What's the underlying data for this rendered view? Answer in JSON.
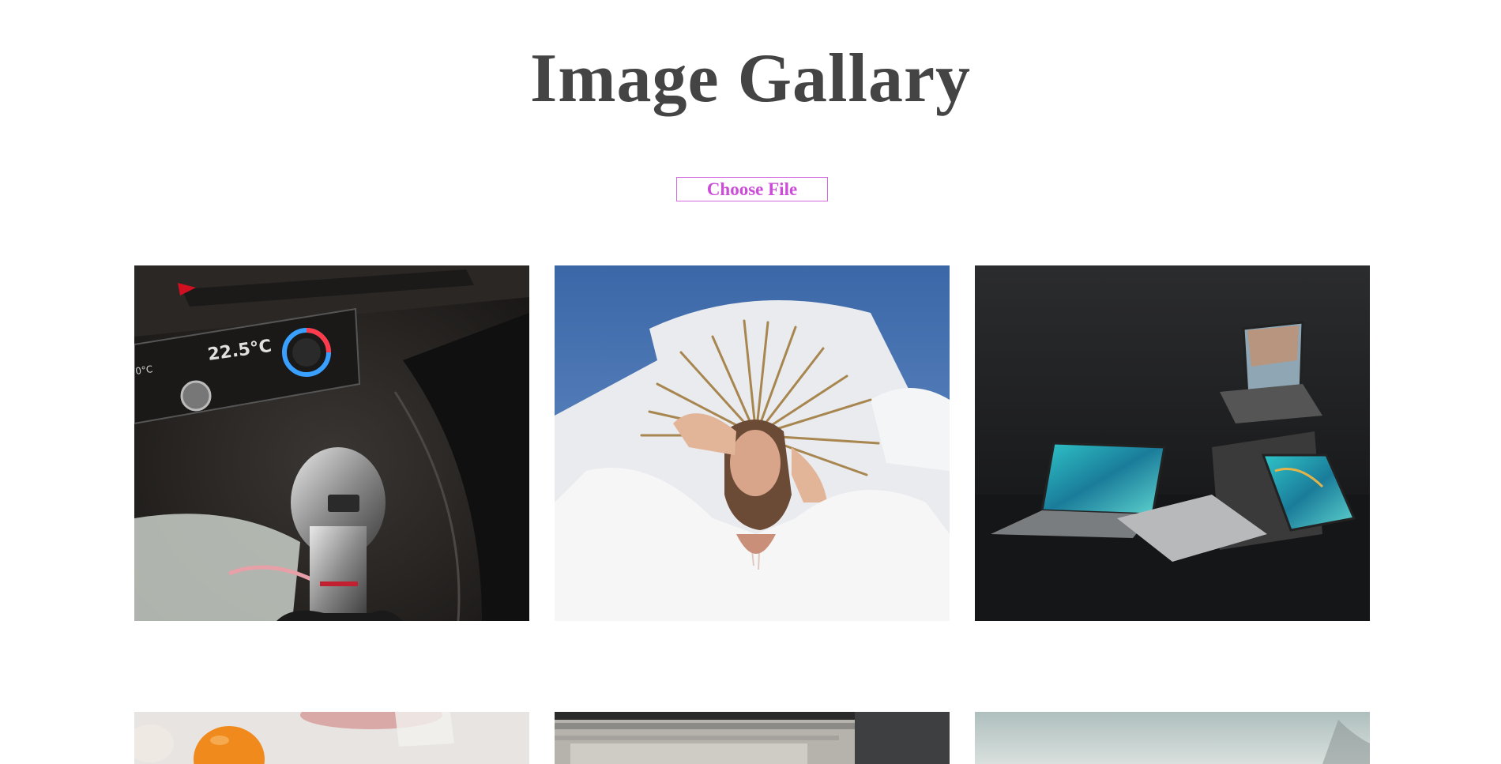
{
  "page": {
    "title": "Image Gallary"
  },
  "upload": {
    "button_label": "Choose File"
  },
  "colors": {
    "title": "#444444",
    "upload_accent": "#cc4cd9",
    "upload_border": "#d36ae0",
    "background": "#ffffff"
  },
  "gallery": {
    "items": [
      {
        "subject": "car gear shift interior",
        "icon": "heart-outline-icon",
        "panel_text": [
          "0°C",
          "22.5°C"
        ]
      },
      {
        "subject": "woman with golden sunburst headpiece",
        "icon": "heart-outline-icon"
      },
      {
        "subject": "laptops on dark background",
        "icon": "heart-outline-icon"
      },
      {
        "subject": "orange and flowers",
        "icon": null
      },
      {
        "subject": "metal shelving",
        "icon": null
      },
      {
        "subject": "pale sky",
        "icon": null
      }
    ]
  }
}
